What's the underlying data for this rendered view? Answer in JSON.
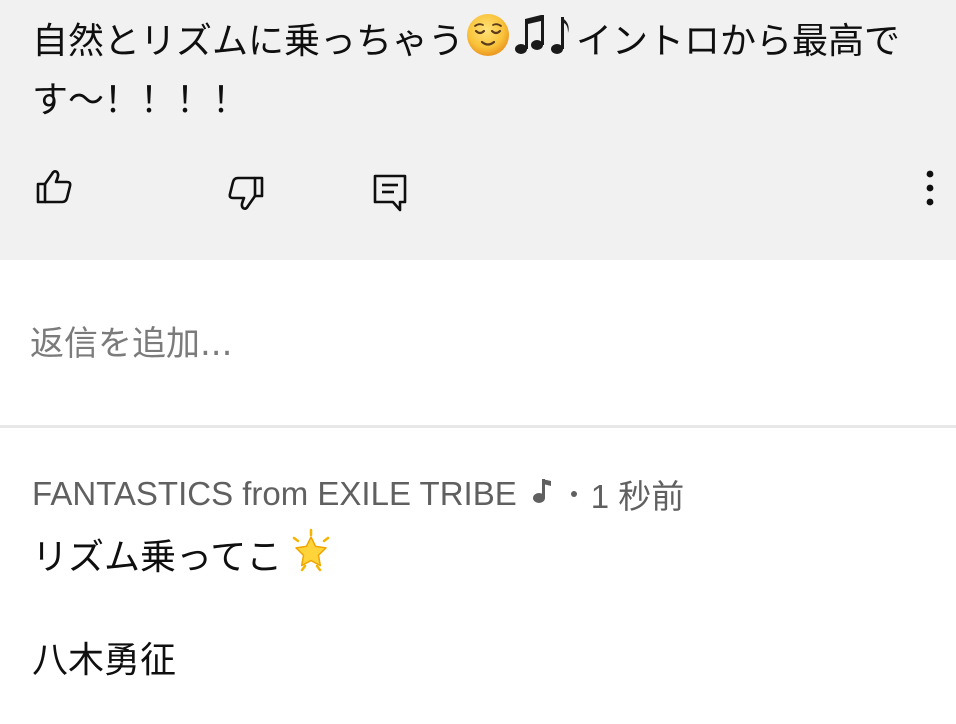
{
  "comment": {
    "text_part1": "自然とリズムに乗っちゃう",
    "emoji1": "relieved-face-emoji",
    "emoji2": "musical-notes-emoji",
    "text_part2": "イントロから最高です〜！！！！"
  },
  "actions": {
    "like": "thumbs-up-icon",
    "dislike": "thumbs-down-icon",
    "reply": "reply-comment-icon",
    "more": "more-vertical-icon"
  },
  "reply_input": {
    "placeholder": "返信を追加..."
  },
  "reply": {
    "author": "FANTASTICS from EXILE TRIBE",
    "badge": "music-note-icon",
    "time": "1 秒前",
    "line1": "リズム乗ってこ",
    "line1_emoji": "glowing-star-emoji",
    "line2": "八木勇征"
  },
  "colors": {
    "top_bg": "#f1f1f1",
    "secondary_text": "#606060",
    "placeholder": "#7b7b7b",
    "divider": "#e8e8e8"
  }
}
